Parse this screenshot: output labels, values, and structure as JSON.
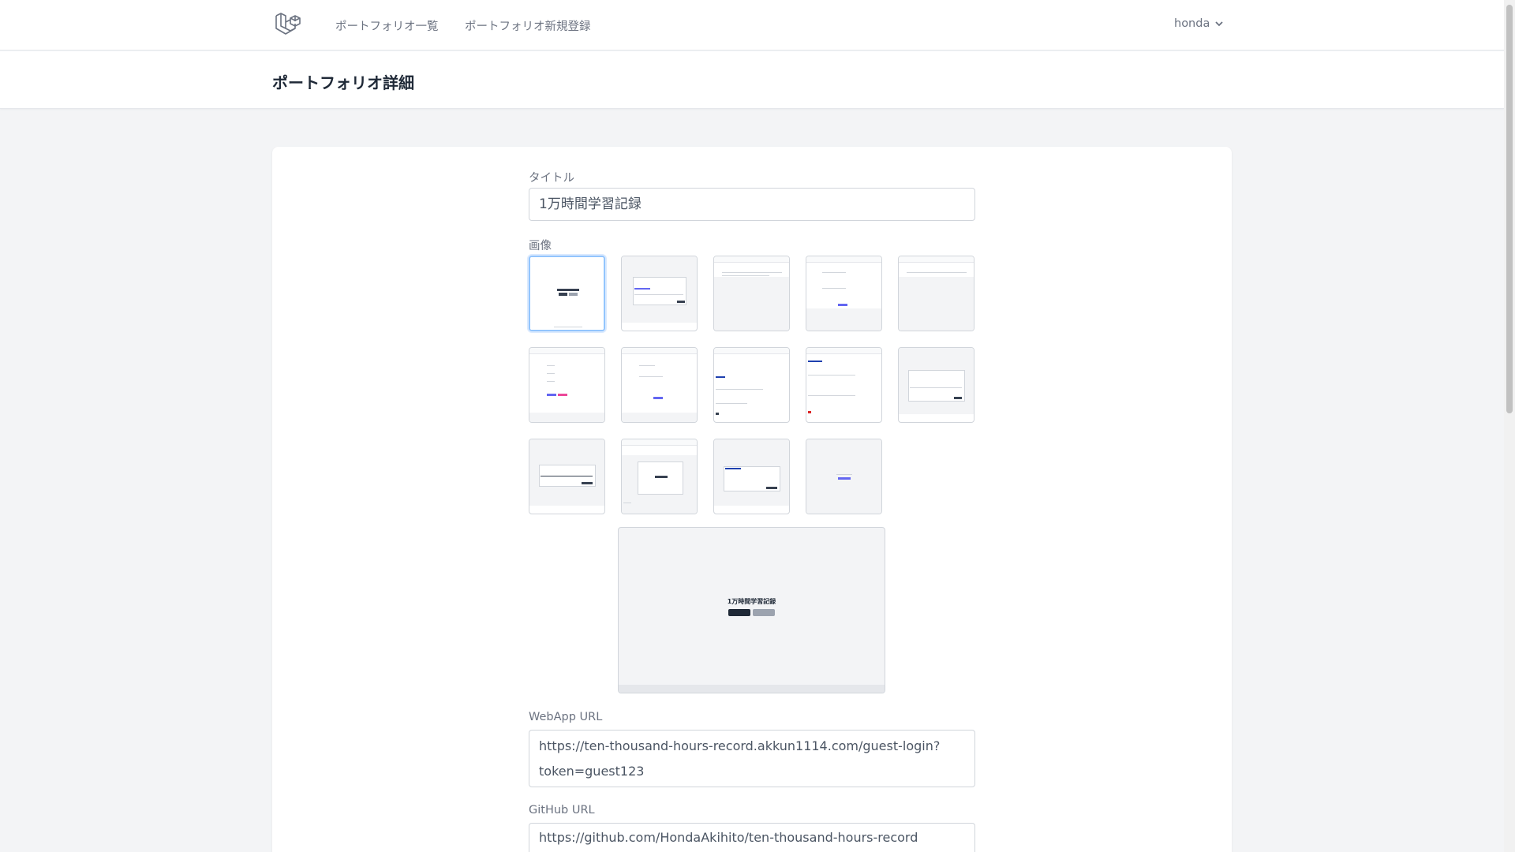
{
  "nav": {
    "logo_icon": "laravel-logo-icon",
    "links": [
      "ポートフォリオ一覧",
      "ポートフォリオ新規登録"
    ],
    "user": "honda"
  },
  "header": {
    "title": "ポートフォリオ詳細"
  },
  "form": {
    "title_label": "タイトル",
    "title_value": "1万時間学習記録",
    "images_label": "画像",
    "thumbnail_count": 14,
    "selected_thumbnail": 1,
    "preview": {
      "title": "1万時間学習記録"
    },
    "webapp_label": "WebApp URL",
    "webapp_value_line1": "https://ten-thousand-hours-record.akkun1114.com/guest-login?",
    "webapp_value_line2": "token=guest123",
    "github_label": "GitHub URL",
    "github_value": "https://github.com/HondaAkihito/ten-thousand-hours-record"
  },
  "colors": {
    "accent": "#6366f1",
    "selected_border": "#93c5fd"
  }
}
